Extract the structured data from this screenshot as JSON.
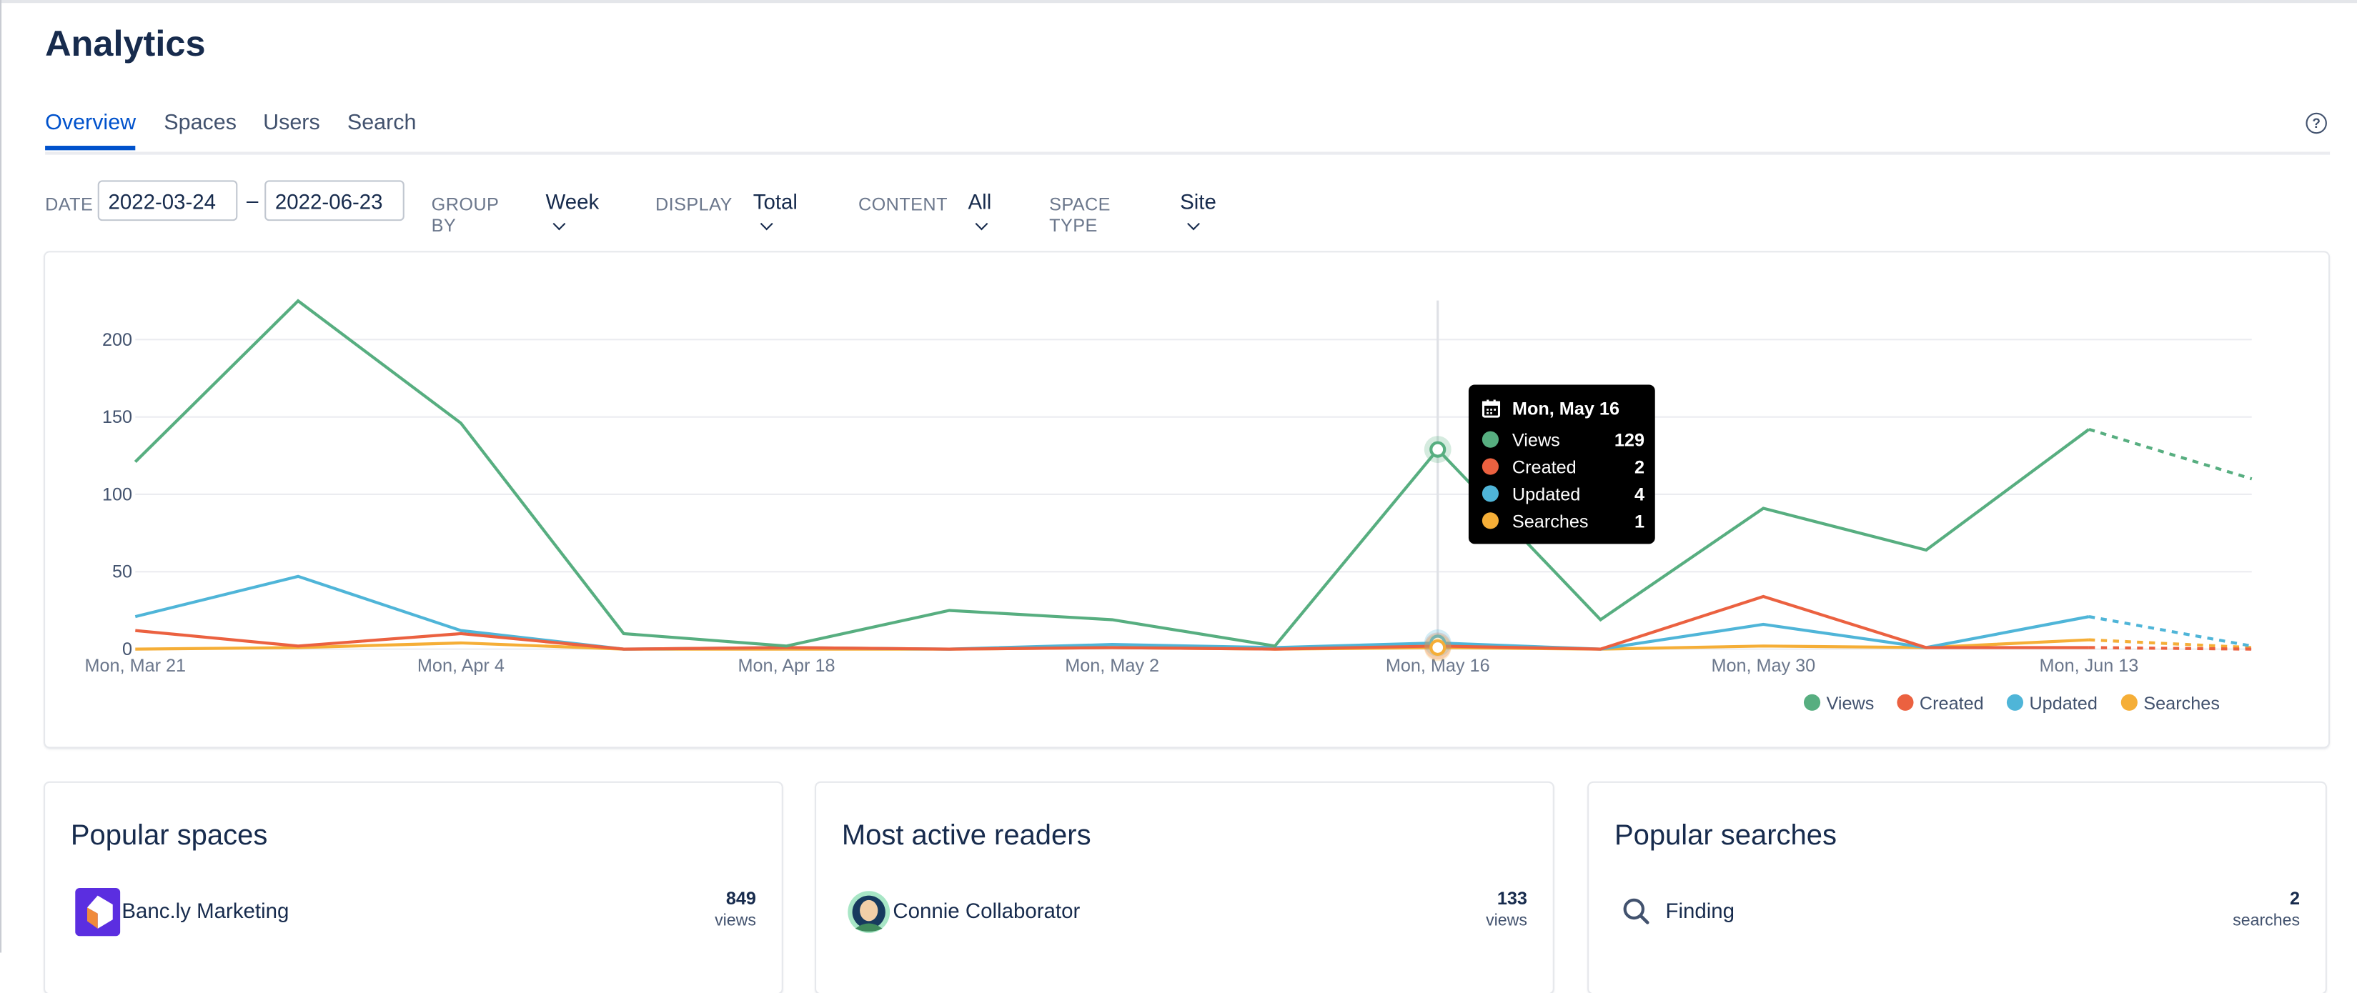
{
  "page": {
    "title": "Analytics",
    "help_icon": "question-circle-icon"
  },
  "tabs": [
    {
      "label": "Overview",
      "active": true
    },
    {
      "label": "Spaces"
    },
    {
      "label": "Users"
    },
    {
      "label": "Search"
    }
  ],
  "filters": {
    "date_label": "DATE",
    "date_from": "2022-03-24",
    "date_sep": "–",
    "date_to": "2022-06-23",
    "group_by_label": "GROUP BY",
    "group_by": "Week",
    "display_label": "DISPLAY",
    "display": "Total",
    "content_label": "CONTENT",
    "content": "All",
    "space_type_label": "SPACE TYPE",
    "space_type": "Site"
  },
  "chart_data": {
    "type": "line",
    "x": [
      "Mon, Mar 21",
      "Mon, Mar 28",
      "Mon, Apr 4",
      "Mon, Apr 11",
      "Mon, Apr 18",
      "Mon, Apr 25",
      "Mon, May 2",
      "Mon, May 9",
      "Mon, May 16",
      "Mon, May 23",
      "Mon, May 30",
      "Mon, Jun 6",
      "Mon, Jun 13",
      "Mon, Jun 20"
    ],
    "x_tick_labels": [
      "Mon, Mar 21",
      "Mon, Apr 4",
      "Mon, Apr 18",
      "Mon, May 2",
      "Mon, May 16",
      "Mon, May 30",
      "Mon, Jun 13"
    ],
    "y_ticks": [
      0,
      50,
      100,
      150,
      200
    ],
    "ylim": [
      0,
      225
    ],
    "grid": true,
    "legend_placement": "bottom-right",
    "last_segment_dashed": true,
    "series": [
      {
        "name": "Views",
        "color": "#57ae80",
        "values": [
          121,
          225,
          146,
          10,
          2,
          25,
          19,
          2,
          129,
          19,
          91,
          64,
          142,
          110
        ]
      },
      {
        "name": "Created",
        "color": "#eb6140",
        "values": [
          12,
          2,
          10,
          0,
          1,
          0,
          1,
          0,
          2,
          0,
          34,
          1,
          1,
          0
        ]
      },
      {
        "name": "Updated",
        "color": "#4fb5d8",
        "values": [
          21,
          47,
          12,
          0,
          1,
          0,
          3,
          1,
          4,
          0,
          16,
          1,
          21,
          2
        ]
      },
      {
        "name": "Searches",
        "color": "#f5ae37",
        "values": [
          0,
          1,
          4,
          0,
          0,
          0,
          1,
          0,
          1,
          0,
          2,
          1,
          6,
          1
        ]
      }
    ],
    "highlight_index": 8,
    "tooltip": {
      "icon": "calendar-icon",
      "title": "Mon, May 16",
      "rows": [
        {
          "label": "Views",
          "value": "129",
          "color": "#57ae80"
        },
        {
          "label": "Created",
          "value": "2",
          "color": "#eb6140"
        },
        {
          "label": "Updated",
          "value": "4",
          "color": "#4fb5d8"
        },
        {
          "label": "Searches",
          "value": "1",
          "color": "#f5ae37"
        }
      ]
    }
  },
  "cards": [
    {
      "title": "Popular spaces",
      "item": {
        "icon": "space-logo-icon",
        "name": "Banc.ly Marketing",
        "count": "849",
        "unit": "views"
      }
    },
    {
      "title": "Most active readers",
      "item": {
        "icon": "avatar",
        "name": "Connie Collaborator",
        "count": "133",
        "unit": "views"
      }
    },
    {
      "title": "Popular searches",
      "item": {
        "icon": "search-icon",
        "name": "Finding",
        "count": "2",
        "unit": "searches"
      }
    }
  ]
}
